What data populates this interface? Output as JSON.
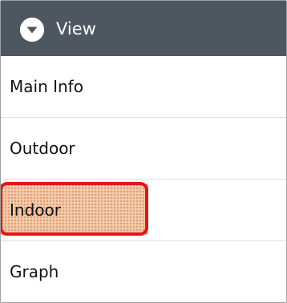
{
  "header": {
    "title": "View",
    "icon": "chevron-down-circle-icon",
    "background": "#4e5760"
  },
  "items": [
    {
      "label": "Main Info"
    },
    {
      "label": "Outdoor"
    },
    {
      "label": "Indoor",
      "highlighted": true
    },
    {
      "label": "Graph"
    }
  ],
  "colors": {
    "highlight_outline": "#e3141b",
    "highlight_fill": "#f2c9a9"
  }
}
